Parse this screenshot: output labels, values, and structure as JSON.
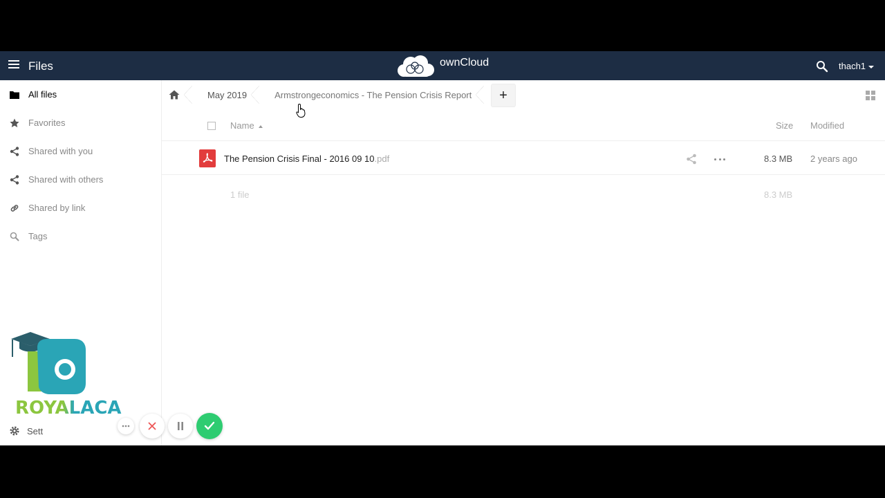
{
  "header": {
    "app_title": "Files",
    "brand": "ownCloud",
    "user": "thach1"
  },
  "sidebar": {
    "items": [
      {
        "label": "All files",
        "icon": "folder-icon",
        "active": true
      },
      {
        "label": "Favorites",
        "icon": "star-icon"
      },
      {
        "label": "Shared with you",
        "icon": "share-icon"
      },
      {
        "label": "Shared with others",
        "icon": "share-icon"
      },
      {
        "label": "Shared by link",
        "icon": "link-icon"
      },
      {
        "label": "Tags",
        "icon": "search-icon"
      }
    ],
    "settings_label": "Sett"
  },
  "watermark": {
    "text": "ROYALACA"
  },
  "breadcrumbs": [
    "May 2019",
    "Armstrongeconomics - The Pension Crisis Report"
  ],
  "new_button": "+",
  "table": {
    "headers": {
      "name": "Name",
      "size": "Size",
      "modified": "Modified"
    },
    "rows": [
      {
        "name": "The Pension Crisis Final - 2016 09 10",
        "ext": ".pdf",
        "size": "8.3 MB",
        "modified": "2 years ago"
      }
    ],
    "summary": {
      "count": "1 file",
      "size": "8.3 MB"
    }
  },
  "colors": {
    "header_bg": "#1d2d44",
    "pdf_red": "#e23c3c",
    "confirm_green": "#2ecc71",
    "watermark_green": "#8cc63f",
    "watermark_teal": "#2aa5b6"
  }
}
